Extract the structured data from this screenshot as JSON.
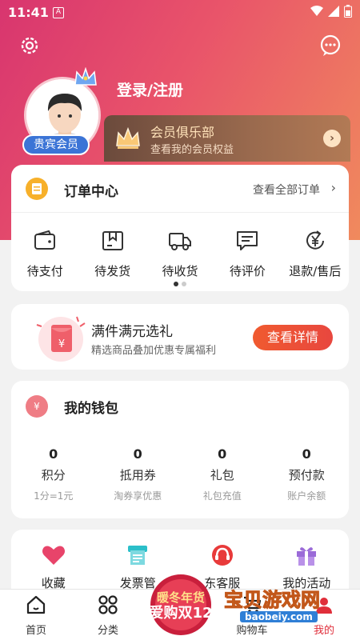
{
  "status_bar": {
    "time": "11:41",
    "notification_icon": "A"
  },
  "header": {
    "settings_icon": "gear-icon",
    "message_icon": "chat-bubble-icon",
    "login_label": "登录/注册",
    "vip_badge": "贵宾会员"
  },
  "member_club": {
    "title": "会员俱乐部",
    "subtitle": "查看我的会员权益",
    "arrow": "›"
  },
  "order_center": {
    "title": "订单中心",
    "view_all": "查看全部订单",
    "chevron": "›",
    "items": [
      {
        "label": "待支付",
        "icon": "wallet-icon"
      },
      {
        "label": "待发货",
        "icon": "box-icon"
      },
      {
        "label": "待收货",
        "icon": "truck-icon"
      },
      {
        "label": "待评价",
        "icon": "comment-icon"
      },
      {
        "label": "退款/售后",
        "icon": "refund-icon"
      }
    ]
  },
  "promo": {
    "title": "满件满元选礼",
    "subtitle": "精选商品叠加优惠专属福利",
    "button": "查看详情"
  },
  "wallet": {
    "title": "我的钱包",
    "icon_text": "¥",
    "items": [
      {
        "value": "0",
        "label": "积分",
        "sub": "1分=1元"
      },
      {
        "value": "0",
        "label": "抵用券",
        "sub": "淘券享优惠"
      },
      {
        "value": "0",
        "label": "礼包",
        "sub": "礼包充值"
      },
      {
        "value": "0",
        "label": "预付款",
        "sub": "账户余额"
      }
    ]
  },
  "services": {
    "items": [
      {
        "label": "收藏",
        "icon": "heart-icon",
        "color": "#e8446a"
      },
      {
        "label": "发票管",
        "icon": "invoice-icon",
        "color": "#2bbfc9"
      },
      {
        "label": "东客服",
        "icon": "headset-icon",
        "color": "#e83a3a"
      },
      {
        "label": "我的活动",
        "icon": "gift-icon",
        "color": "#9b6bd8"
      }
    ]
  },
  "tabbar": {
    "items": [
      {
        "label": "首页",
        "icon": "home-icon"
      },
      {
        "label": "分类",
        "icon": "grid-icon"
      },
      {
        "label": "",
        "icon": "promo-icon"
      },
      {
        "label": "购物车",
        "icon": "cart-icon"
      },
      {
        "label": "我的",
        "icon": "profile-icon"
      }
    ]
  },
  "floating_promo": {
    "line1": "暖冬年货",
    "line2": "爱购双12"
  },
  "watermark": {
    "text": "宝贝游戏网",
    "url": "baobeiy.com"
  },
  "colors": {
    "accent": "#e02e3a",
    "header_start": "#d8356f",
    "header_end": "#f08a5d",
    "gold": "#ffe2b9"
  }
}
